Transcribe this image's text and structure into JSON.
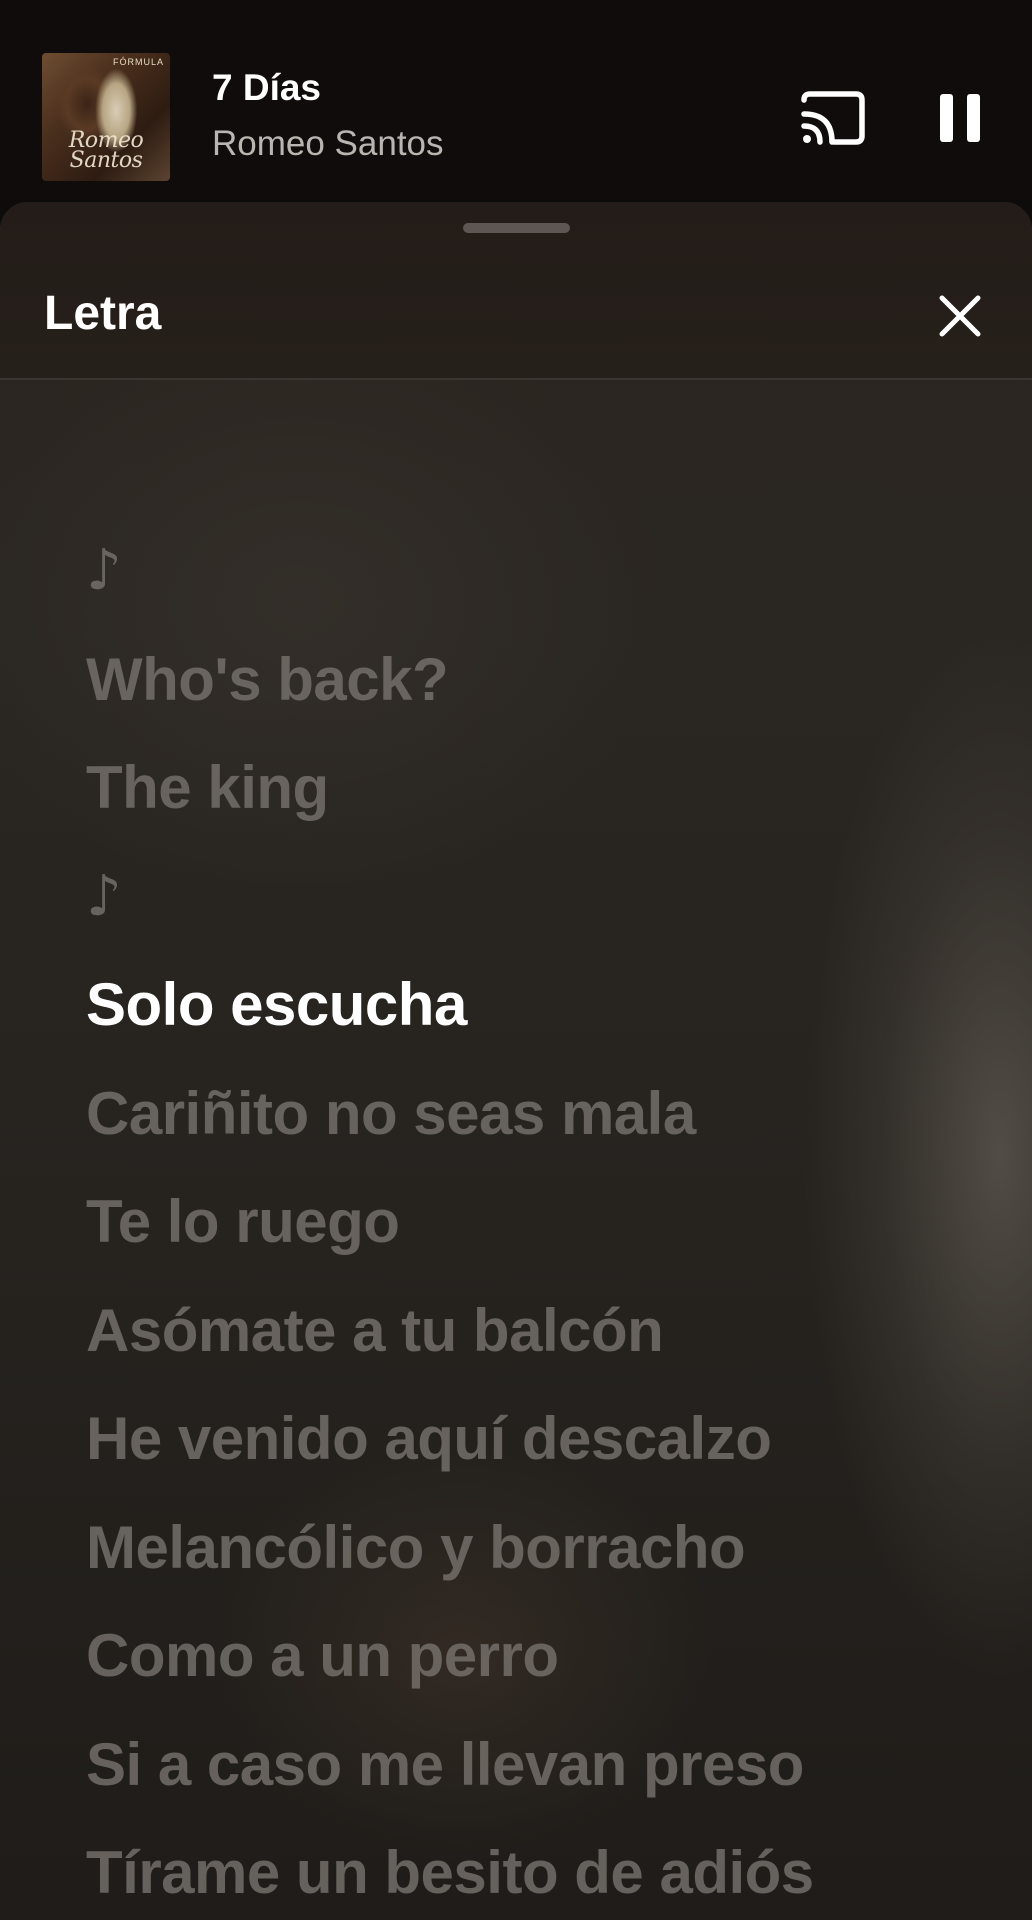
{
  "mini_player": {
    "track_title": "7 Días",
    "artist": "Romeo Santos",
    "album_art_text": "Romeo Santos",
    "album_art_small_text": "FÓRMULA",
    "icons": {
      "cast": "cast-icon",
      "pause": "pause-icon"
    }
  },
  "lyrics_sheet": {
    "title": "Letra",
    "close_icon": "close-icon",
    "current_line_index": 4,
    "lines": [
      "♪",
      "Who's back?",
      "The king",
      "♪",
      "Solo escucha",
      "Cariñito no seas mala",
      "Te lo ruego",
      "Asómate a tu balcón",
      "He venido aquí descalzo",
      "Melancólico y borracho",
      "Como a un perro",
      "Si a caso me llevan preso",
      "Tírame un besito de adiós"
    ]
  },
  "colors": {
    "background": "#0e0c0b",
    "text_primary": "#ffffff",
    "text_secondary": "#b9b6b2",
    "lyric_inactive": "#7a7570"
  }
}
